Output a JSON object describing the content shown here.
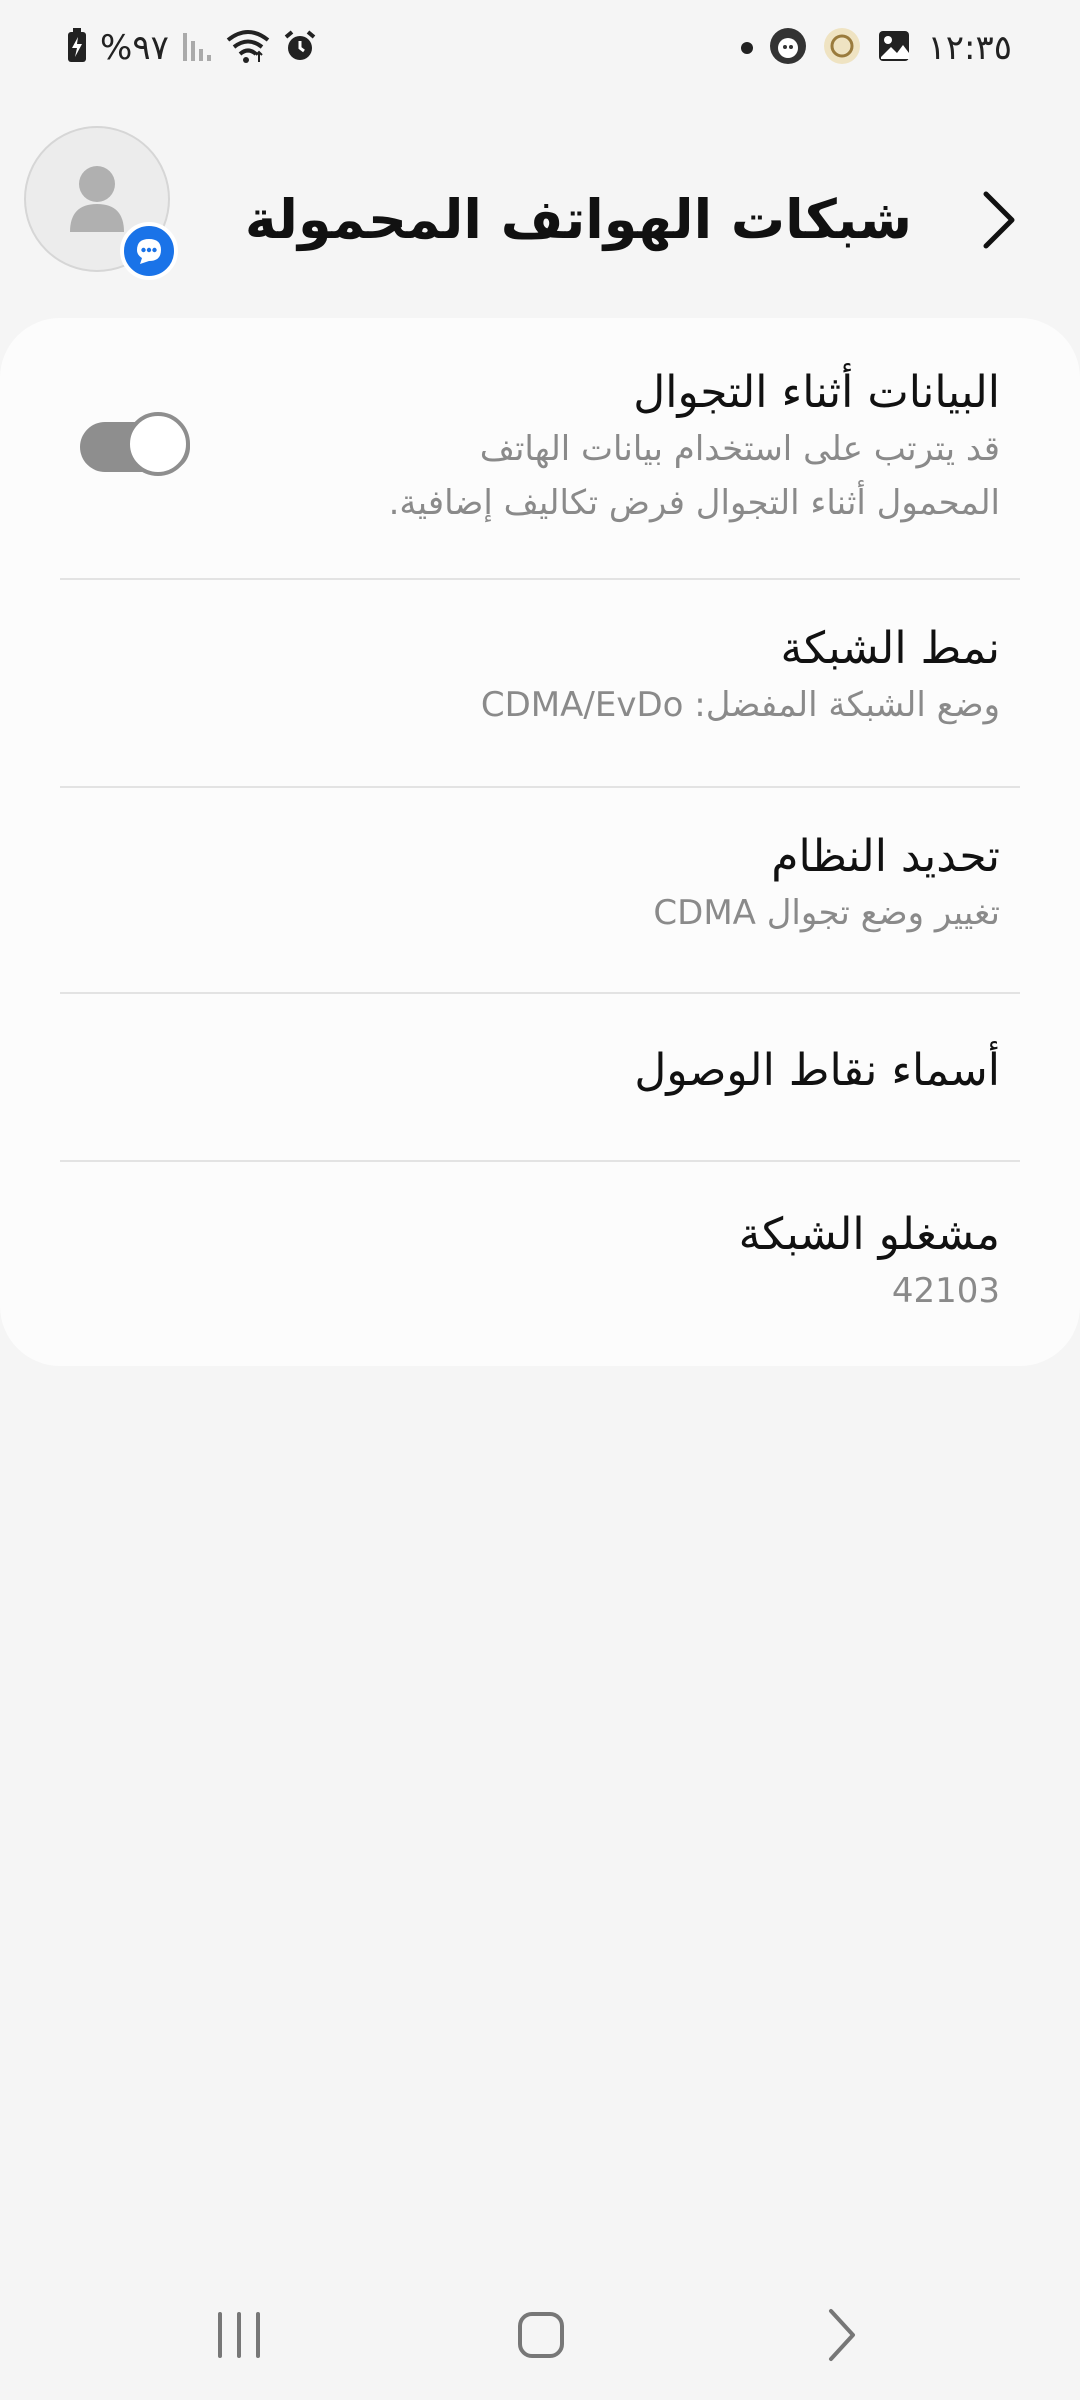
{
  "status_bar": {
    "time": "١٢:٣٥",
    "battery": "%٩٧",
    "icons": [
      "battery-charging-icon",
      "signal-icon",
      "wifi-icon",
      "alarm-icon",
      "dot-icon",
      "app-icon",
      "app-icon-2",
      "image-icon"
    ]
  },
  "header": {
    "title": "شبكات الهواتف المحمولة",
    "back_icon": "chevron-right-icon"
  },
  "settings": [
    {
      "title": "البيانات أثناء التجوال",
      "subtitle": "قد يترتب على استخدام بيانات الهاتف المحمول أثناء التجوال فرض تكاليف إضافية.",
      "toggle_on": false
    },
    {
      "title": "نمط الشبكة",
      "subtitle": "وضع الشبكة المفضل: CDMA/EvDo"
    },
    {
      "title": "تحديد النظام",
      "subtitle": "تغيير وضع تجوال CDMA"
    },
    {
      "title": "أسماء نقاط الوصول"
    },
    {
      "title": "مشغلو الشبكة",
      "subtitle": "42103"
    }
  ],
  "colors": {
    "background": "#f5f5f5",
    "card": "#fcfcfc",
    "accent_badge": "#1a73e8",
    "toggle_off": "#8e8e8e"
  }
}
